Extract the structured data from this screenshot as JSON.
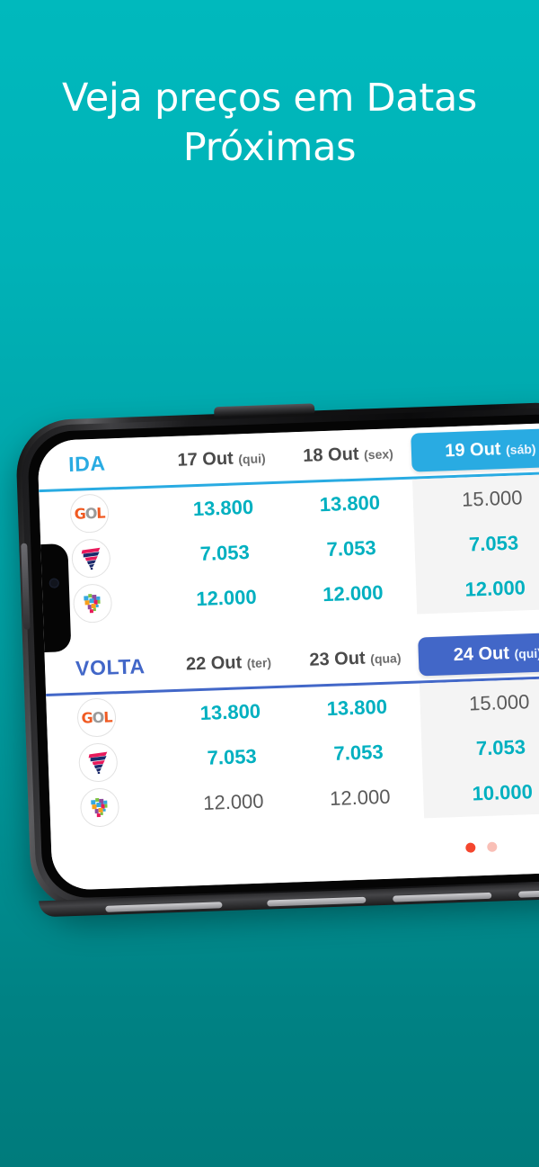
{
  "promo": {
    "headline_line1": "Veja preços em Datas",
    "headline_line2": "Próximas"
  },
  "app": {
    "ida": {
      "label": "IDA",
      "accent": "#29abe2",
      "dates": [
        {
          "day": "17 Out",
          "dow": "(qui)",
          "selected": false
        },
        {
          "day": "18 Out",
          "dow": "(sex)",
          "selected": false
        },
        {
          "day": "19 Out",
          "dow": "(sáb)",
          "selected": true
        }
      ],
      "rows": [
        {
          "airline": "gol-logo",
          "prices": [
            "13.800",
            "13.800",
            "15.000"
          ],
          "muted": [
            false,
            false,
            true
          ]
        },
        {
          "airline": "latam-logo",
          "prices": [
            "7.053",
            "7.053",
            "7.053"
          ],
          "muted": [
            false,
            false,
            false
          ]
        },
        {
          "airline": "azul-logo",
          "prices": [
            "12.000",
            "12.000",
            "12.000"
          ],
          "muted": [
            false,
            false,
            false
          ]
        }
      ]
    },
    "volta": {
      "label": "VOLTA",
      "accent": "#4267c8",
      "dates": [
        {
          "day": "22 Out",
          "dow": "(ter)",
          "selected": false
        },
        {
          "day": "23 Out",
          "dow": "(qua)",
          "selected": false
        },
        {
          "day": "24 Out",
          "dow": "(qui)",
          "selected": true
        }
      ],
      "rows": [
        {
          "airline": "gol-logo",
          "prices": [
            "13.800",
            "13.800",
            "15.000"
          ],
          "muted": [
            false,
            false,
            true
          ]
        },
        {
          "airline": "latam-logo",
          "prices": [
            "7.053",
            "7.053",
            "7.053"
          ],
          "muted": [
            false,
            false,
            false
          ]
        },
        {
          "airline": "azul-logo",
          "prices": [
            "12.000",
            "12.000",
            "10.000"
          ],
          "muted": [
            true,
            true,
            false
          ]
        }
      ]
    },
    "pagination": {
      "active_index": 0,
      "count": 2,
      "active_color": "#f4462e",
      "inactive_color": "#f9bfb6"
    }
  },
  "theme": {
    "background_top": "#00b9bd",
    "background_bottom": "#007b7c",
    "headline_color": "#ffffff",
    "price_color": "#00b0c0",
    "muted_price_color": "#5a5a5a"
  }
}
